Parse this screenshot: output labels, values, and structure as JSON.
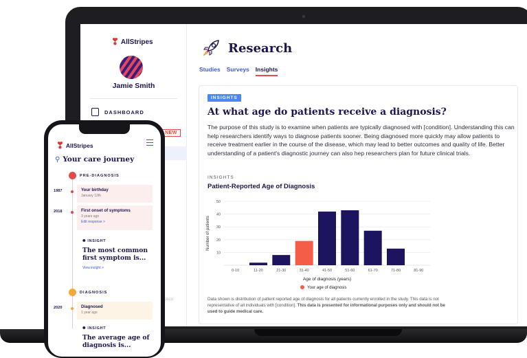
{
  "colors": {
    "navy": "#1c1650",
    "accent_red": "#e5484d",
    "bar_navy": "#1d1460",
    "bar_highlight": "#f45d48",
    "link_blue": "#3d5bd9",
    "tag_blue": "#4c86f0",
    "stage_orange": "#f6a93b"
  },
  "laptop": {
    "sidebar": {
      "brand": "AllStripes",
      "user_name": "Jamie Smith",
      "nav_dashboard": "DASHBOARD",
      "new_badge": "NEW",
      "footer_fragment": "ncisco"
    },
    "page": {
      "title": "Research",
      "tabs": [
        {
          "label": "Studies",
          "active": false
        },
        {
          "label": "Surveys",
          "active": false
        },
        {
          "label": "Insights",
          "active": true
        }
      ]
    },
    "card": {
      "tag": "INSIGHTS",
      "question": "At what age do patients receive a diagnosis?",
      "body": "The purpose of this study is to examine when patients are typically diagnosed with [condition]. Understanding this can help researchers identify ways to diagnose patients sooner. Being diagnosed more quickly may allow patients to receive treatment earlier in the course of the disease, which may lead to better outcomes and quality of life. Better understanding of a patient's diagnostic journey can also hep researchers plan for future clinical trials.",
      "section_kicker": "INSIGHTS",
      "chart_heading": "Patient-Reported Age of Diagnosis",
      "note_plain": "Data shown is distribution of patient reported age of diagnosis for all patients currently enrolled in the study. This data is not representative of all individuals with [condition]. ",
      "note_bold": "This data is presented for informational purposes only and should not be used to guide medical care."
    }
  },
  "chart_data": {
    "type": "bar",
    "categories": [
      "0-10",
      "11-20",
      "21-30",
      "31-40",
      "41-50",
      "51-60",
      "61-70",
      "71-80",
      "81-90"
    ],
    "values": [
      0,
      2,
      8,
      19,
      42,
      43,
      27,
      13,
      0
    ],
    "highlight_category": "31-40",
    "xlabel": "Age of diagnosis (years)",
    "ylabel": "Number of patients",
    "ylim": [
      0,
      50
    ],
    "yticks": [
      10,
      20,
      30,
      40,
      50
    ],
    "legend": "Your age of diagnosis",
    "legend_position": "bottom",
    "grid": true
  },
  "phone": {
    "brand": "AllStripes",
    "heading": "Your care journey",
    "stage_pre": "PRE-DIAGNOSIS",
    "stage_diag": "DIAGNOSIS",
    "events": [
      {
        "year": "1987",
        "title": "Your birthday",
        "sub": "January 12th"
      },
      {
        "year": "2018",
        "title": "First onset of symptoms",
        "sub": "3 years ago",
        "link": "Edit response >"
      },
      {
        "year": "2020",
        "title": "Diagnosed",
        "sub": "1 year ago"
      }
    ],
    "insights": [
      {
        "kicker": "INSIGHT",
        "title": "The most common first symptom is...",
        "link": "View insight >"
      },
      {
        "kicker": "INSIGHT",
        "title": "The average age of diagnosis is..."
      }
    ]
  }
}
